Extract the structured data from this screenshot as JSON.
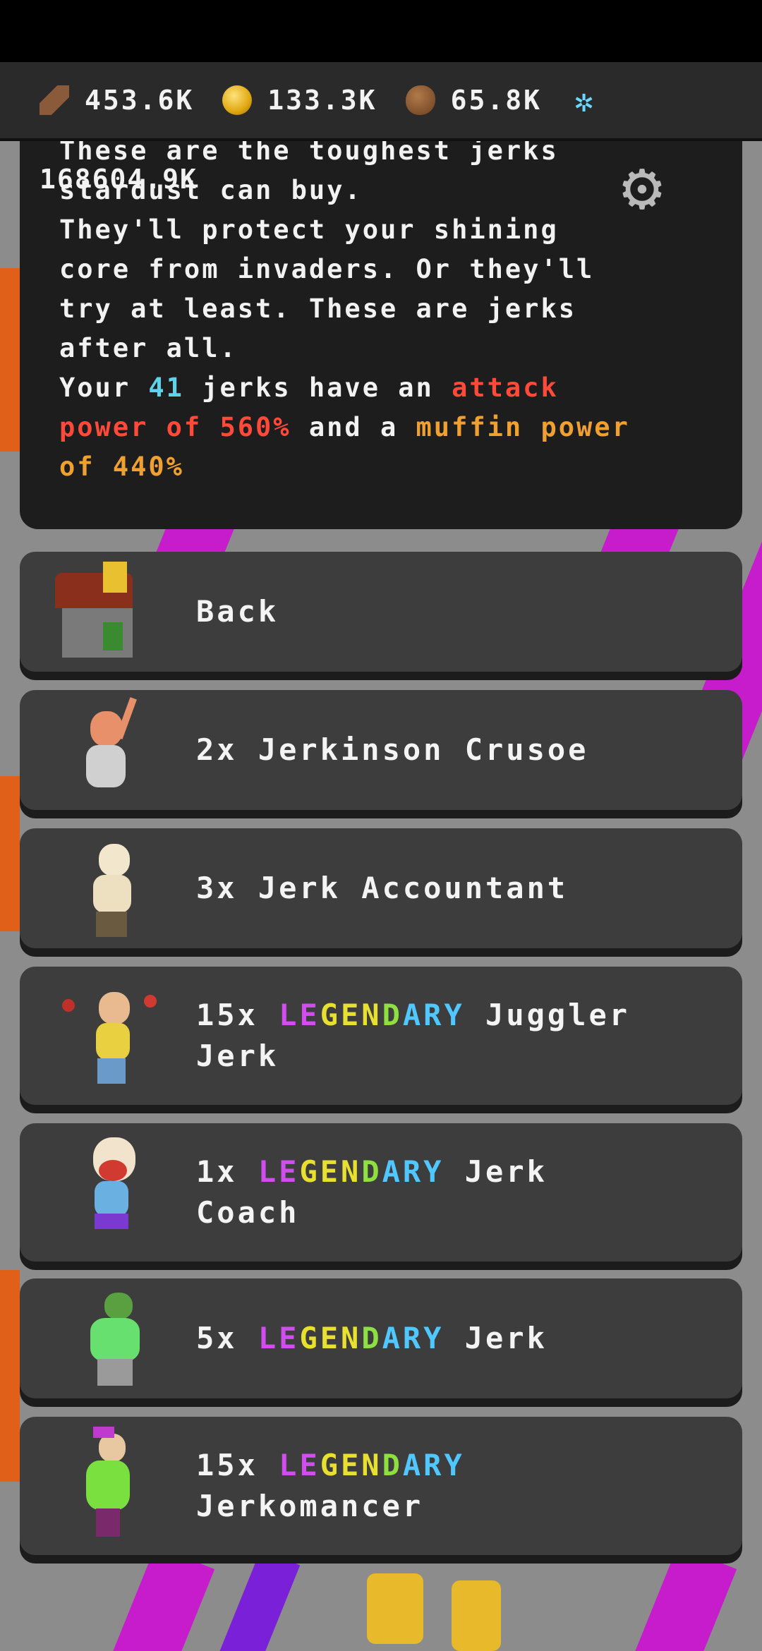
{
  "resources": [
    {
      "icon": "log-icon",
      "value": "453.6K"
    },
    {
      "icon": "coin-icon",
      "value": "133.3K"
    },
    {
      "icon": "seed-icon",
      "value": "65.8K"
    },
    {
      "icon": "stardust-icon",
      "value": ""
    }
  ],
  "counter": "168604.9K",
  "panel": {
    "line1": "These are the toughest jerks",
    "line2": "stardust can buy.",
    "line3": "They'll protect your shining",
    "line4": "core from invaders. Or they'll",
    "line5": "try at least. These are jerks",
    "line6": "after all.",
    "line7_a": "Your ",
    "count": "41",
    "line7_b": " jerks have an ",
    "attack": "attack",
    "line8_a": "power of 560%",
    "line8_b": " and a ",
    "muffin": "muffin power",
    "line9": "of 440%"
  },
  "buttons": {
    "back": "Back",
    "crusoe": "2x Jerkinson Crusoe",
    "accountant": "3x Jerk Accountant",
    "juggler_count": "15x",
    "juggler_name": "Juggler",
    "juggler_name2": "Jerk",
    "coach_count": "1x",
    "coach_name": "Jerk",
    "coach_name2": "Coach",
    "jerk_count": "5x",
    "jerk_name": "Jerk",
    "mancer_count": "15x",
    "mancer_name": "Jerkomancer"
  },
  "legendary": {
    "le": "LE",
    "gen": "GEN",
    "d": "D",
    "ary": "ARY"
  },
  "colors": {
    "panel_bg": "#1d1d1d",
    "button_bg": "#3d3d3d",
    "cyan": "#5fd4e8",
    "red": "#ff4a3a",
    "orange": "#f0a030"
  }
}
